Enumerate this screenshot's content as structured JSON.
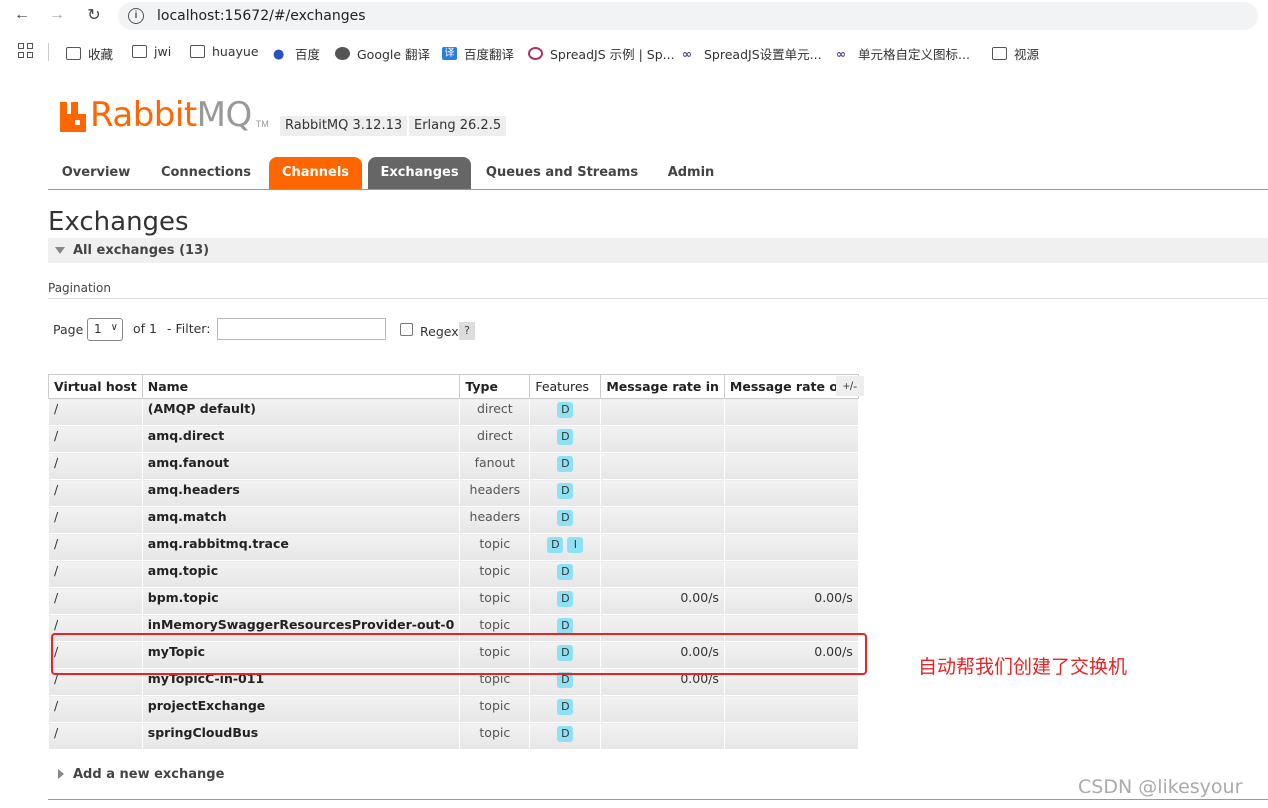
{
  "browser": {
    "url": "localhost:15672/#/exchanges",
    "bookmarks": [
      "收藏",
      "jwi",
      "huayue",
      "百度",
      "Google 翻译",
      "百度翻译",
      "SpreadJS 示例 | Sp...",
      "SpreadJS设置单元...",
      "单元格自定义图标...",
      "视源"
    ]
  },
  "header": {
    "logo_main": "Rabbit",
    "logo_mq": "MQ",
    "logo_tm": "TM",
    "rabbitmq_version": "RabbitMQ 3.12.13",
    "erlang_version": "Erlang 26.2.5"
  },
  "tabs": [
    "Overview",
    "Connections",
    "Channels",
    "Exchanges",
    "Queues and Streams",
    "Admin"
  ],
  "page": {
    "title": "Exchanges",
    "section": "All exchanges (13)",
    "pagination_label": "Pagination",
    "page_label": "Page",
    "page_value": "1",
    "of_label": "of 1",
    "filter_label": "- Filter:",
    "regex_label": "Regex",
    "help": "?",
    "plus_minus": "+/-",
    "add_new": "Add a new exchange"
  },
  "table": {
    "columns": [
      "Virtual host",
      "Name",
      "Type",
      "Features",
      "Message rate in",
      "Message rate out"
    ],
    "rows": [
      {
        "vhost": "/",
        "name": "(AMQP default)",
        "type": "direct",
        "features": [
          "D"
        ],
        "rate_in": "",
        "rate_out": ""
      },
      {
        "vhost": "/",
        "name": "amq.direct",
        "type": "direct",
        "features": [
          "D"
        ],
        "rate_in": "",
        "rate_out": ""
      },
      {
        "vhost": "/",
        "name": "amq.fanout",
        "type": "fanout",
        "features": [
          "D"
        ],
        "rate_in": "",
        "rate_out": ""
      },
      {
        "vhost": "/",
        "name": "amq.headers",
        "type": "headers",
        "features": [
          "D"
        ],
        "rate_in": "",
        "rate_out": ""
      },
      {
        "vhost": "/",
        "name": "amq.match",
        "type": "headers",
        "features": [
          "D"
        ],
        "rate_in": "",
        "rate_out": ""
      },
      {
        "vhost": "/",
        "name": "amq.rabbitmq.trace",
        "type": "topic",
        "features": [
          "D",
          "I"
        ],
        "rate_in": "",
        "rate_out": ""
      },
      {
        "vhost": "/",
        "name": "amq.topic",
        "type": "topic",
        "features": [
          "D"
        ],
        "rate_in": "",
        "rate_out": ""
      },
      {
        "vhost": "/",
        "name": "bpm.topic",
        "type": "topic",
        "features": [
          "D"
        ],
        "rate_in": "0.00/s",
        "rate_out": "0.00/s"
      },
      {
        "vhost": "/",
        "name": "inMemorySwaggerResourcesProvider-out-0",
        "type": "topic",
        "features": [
          "D"
        ],
        "rate_in": "",
        "rate_out": ""
      },
      {
        "vhost": "/",
        "name": "myTopic",
        "type": "topic",
        "features": [
          "D"
        ],
        "rate_in": "0.00/s",
        "rate_out": "0.00/s"
      },
      {
        "vhost": "/",
        "name": "myTopicC-in-011",
        "type": "topic",
        "features": [
          "D"
        ],
        "rate_in": "0.00/s",
        "rate_out": ""
      },
      {
        "vhost": "/",
        "name": "projectExchange",
        "type": "topic",
        "features": [
          "D"
        ],
        "rate_in": "",
        "rate_out": ""
      },
      {
        "vhost": "/",
        "name": "springCloudBus",
        "type": "topic",
        "features": [
          "D"
        ],
        "rate_in": "",
        "rate_out": ""
      }
    ]
  },
  "annotation": "自动帮我们创建了交换机",
  "watermark": "CSDN @likesyour",
  "colors": {
    "brand": "#ff6600",
    "active_tab": "#666666",
    "annotation": "#e52525",
    "feature_badge": "#8ee0f5"
  }
}
